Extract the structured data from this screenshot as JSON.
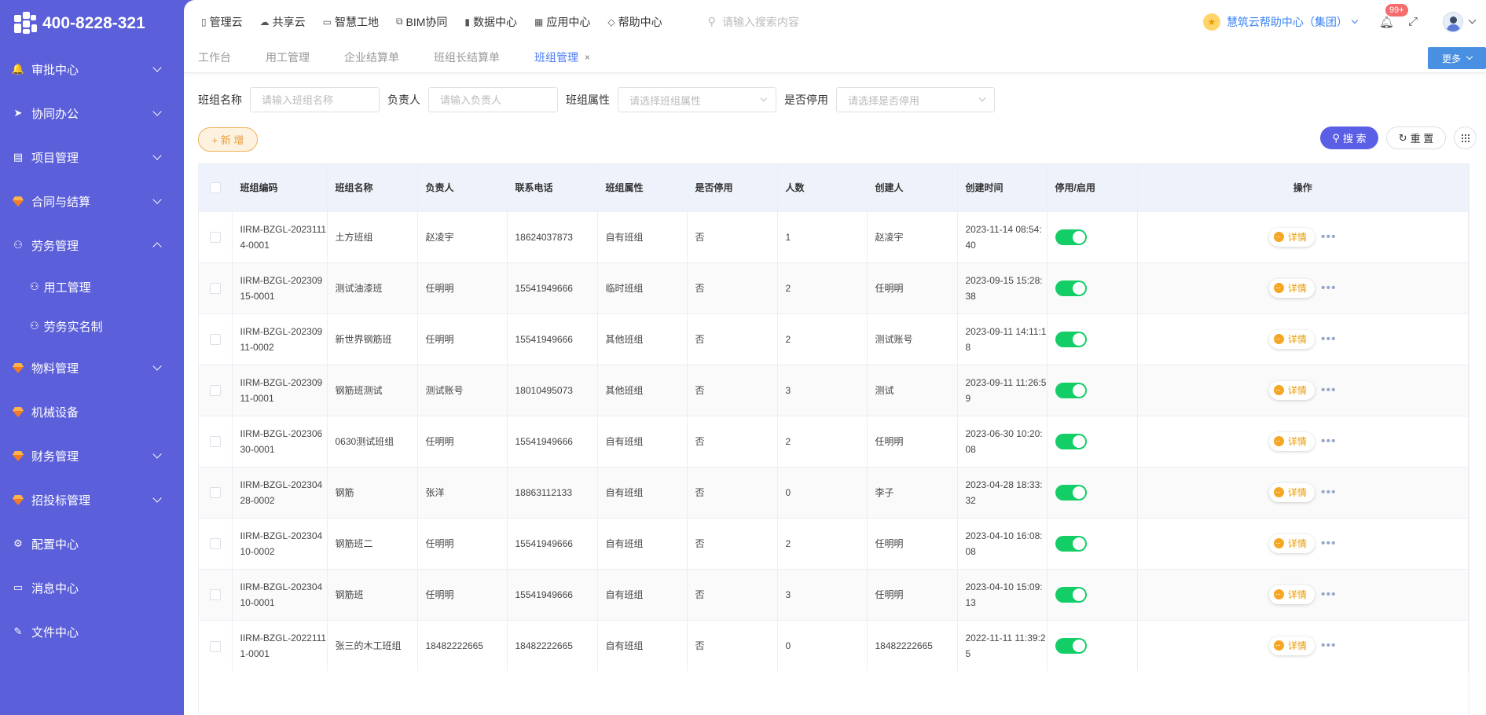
{
  "app": {
    "phone": "400-8228-321"
  },
  "sidebar": {
    "items": [
      {
        "label": "审批中心",
        "icon": "bell-icon",
        "glyph": "🔔",
        "chevron": "down"
      },
      {
        "label": "协同办公",
        "icon": "send-icon",
        "glyph": "➤",
        "chevron": "down"
      },
      {
        "label": "项目管理",
        "icon": "book-icon",
        "glyph": "▤",
        "chevron": "down"
      },
      {
        "label": "合同与结算",
        "icon": "gem-icon",
        "glyph": "",
        "chevron": "down"
      },
      {
        "label": "劳务管理",
        "icon": "user-icon",
        "glyph": "⚇",
        "chevron": "up"
      }
    ],
    "sub_items": [
      {
        "label": "用工管理",
        "icon": "user-icon"
      },
      {
        "label": "劳务实名制",
        "icon": "user-icon"
      }
    ],
    "items_after": [
      {
        "label": "物料管理",
        "icon": "gem-icon",
        "chevron": "down"
      },
      {
        "label": "机械设备",
        "icon": "gem-icon",
        "chevron": ""
      },
      {
        "label": "财务管理",
        "icon": "gem-icon",
        "chevron": "down"
      },
      {
        "label": "招投标管理",
        "icon": "gem-icon",
        "chevron": "down"
      },
      {
        "label": "配置中心",
        "icon": "gear-icon",
        "glyph": "⚙",
        "chevron": ""
      },
      {
        "label": "消息中心",
        "icon": "message-icon",
        "glyph": "▭",
        "chevron": ""
      },
      {
        "label": "文件中心",
        "icon": "file-icon",
        "glyph": "✎",
        "chevron": ""
      }
    ]
  },
  "topnav": [
    {
      "label": "管理云",
      "icon": "page-icon",
      "glyph": "▯"
    },
    {
      "label": "共享云",
      "icon": "cloud-icon",
      "glyph": "☁"
    },
    {
      "label": "智慧工地",
      "icon": "board-icon",
      "glyph": "▭"
    },
    {
      "label": "BIM协同",
      "icon": "cube-icon",
      "glyph": "⧉"
    },
    {
      "label": "数据中心",
      "icon": "chart-icon",
      "glyph": "▮"
    },
    {
      "label": "应用中心",
      "icon": "apps-icon",
      "glyph": "▦"
    },
    {
      "label": "帮助中心",
      "icon": "diamond-icon",
      "glyph": "◇"
    }
  ],
  "search": {
    "placeholder": "请输入搜索内容"
  },
  "header": {
    "org": "慧筑云帮助中心（集团）",
    "badge": "99+"
  },
  "tabs": [
    {
      "label": "工作台",
      "active": false
    },
    {
      "label": "用工管理",
      "active": false
    },
    {
      "label": "企业结算单",
      "active": false
    },
    {
      "label": "班组长结算单",
      "active": false
    },
    {
      "label": "班组管理",
      "active": true
    }
  ],
  "more_label": "更多",
  "filters": {
    "name_label": "班组名称",
    "name_placeholder": "请输入班组名称",
    "owner_label": "负责人",
    "owner_placeholder": "请输入负责人",
    "attr_label": "班组属性",
    "attr_placeholder": "请选择班组属性",
    "disabled_label": "是否停用",
    "disabled_placeholder": "请选择是否停用"
  },
  "buttons": {
    "add": "+ 新 增",
    "search": "搜 索",
    "reset": "重 置"
  },
  "table": {
    "columns": [
      "班组编码",
      "班组名称",
      "负责人",
      "联系电话",
      "班组属性",
      "是否停用",
      "人数",
      "创建人",
      "创建时间",
      "停用/启用",
      "操作"
    ],
    "detail_label": "详情",
    "rows": [
      {
        "code": "IIRM-BZGL-20231114-0001",
        "name": "土方班组",
        "owner": "赵凌宇",
        "phone": "18624037873",
        "attr": "自有班组",
        "disabled": "否",
        "count": "1",
        "creator": "赵凌宇",
        "created": "2023-11-14 08:54:40"
      },
      {
        "code": "IIRM-BZGL-20230915-0001",
        "name": "测试油漆班",
        "owner": "任明明",
        "phone": "15541949666",
        "attr": "临时班组",
        "disabled": "否",
        "count": "2",
        "creator": "任明明",
        "created": "2023-09-15 15:28:38"
      },
      {
        "code": "IIRM-BZGL-20230911-0002",
        "name": "新世界钢筋班",
        "owner": "任明明",
        "phone": "15541949666",
        "attr": "其他班组",
        "disabled": "否",
        "count": "2",
        "creator": "测试账号",
        "created": "2023-09-11 14:11:18"
      },
      {
        "code": "IIRM-BZGL-20230911-0001",
        "name": "钢筋班测试",
        "owner": "测试账号",
        "phone": "18010495073",
        "attr": "其他班组",
        "disabled": "否",
        "count": "3",
        "creator": "测试",
        "created": "2023-09-11 11:26:59"
      },
      {
        "code": "IIRM-BZGL-20230630-0001",
        "name": "0630测试班组",
        "owner": "任明明",
        "phone": "15541949666",
        "attr": "自有班组",
        "disabled": "否",
        "count": "2",
        "creator": "任明明",
        "created": "2023-06-30 10:20:08"
      },
      {
        "code": "IIRM-BZGL-20230428-0002",
        "name": "钢筋",
        "owner": "张洋",
        "phone": "18863112133",
        "attr": "自有班组",
        "disabled": "否",
        "count": "0",
        "creator": "李子",
        "created": "2023-04-28 18:33:32"
      },
      {
        "code": "IIRM-BZGL-20230410-0002",
        "name": "钢筋班二",
        "owner": "任明明",
        "phone": "15541949666",
        "attr": "自有班组",
        "disabled": "否",
        "count": "2",
        "creator": "任明明",
        "created": "2023-04-10 16:08:08"
      },
      {
        "code": "IIRM-BZGL-20230410-0001",
        "name": "钢筋班",
        "owner": "任明明",
        "phone": "15541949666",
        "attr": "自有班组",
        "disabled": "否",
        "count": "3",
        "creator": "任明明",
        "created": "2023-04-10 15:09:13"
      },
      {
        "code": "IIRM-BZGL-20221111-0001",
        "name": "张三的木工班组",
        "owner": "18482222665",
        "phone": "18482222665",
        "attr": "自有班组",
        "disabled": "否",
        "count": "0",
        "creator": "18482222665",
        "created": "2022-11-11 11:39:25"
      }
    ]
  }
}
